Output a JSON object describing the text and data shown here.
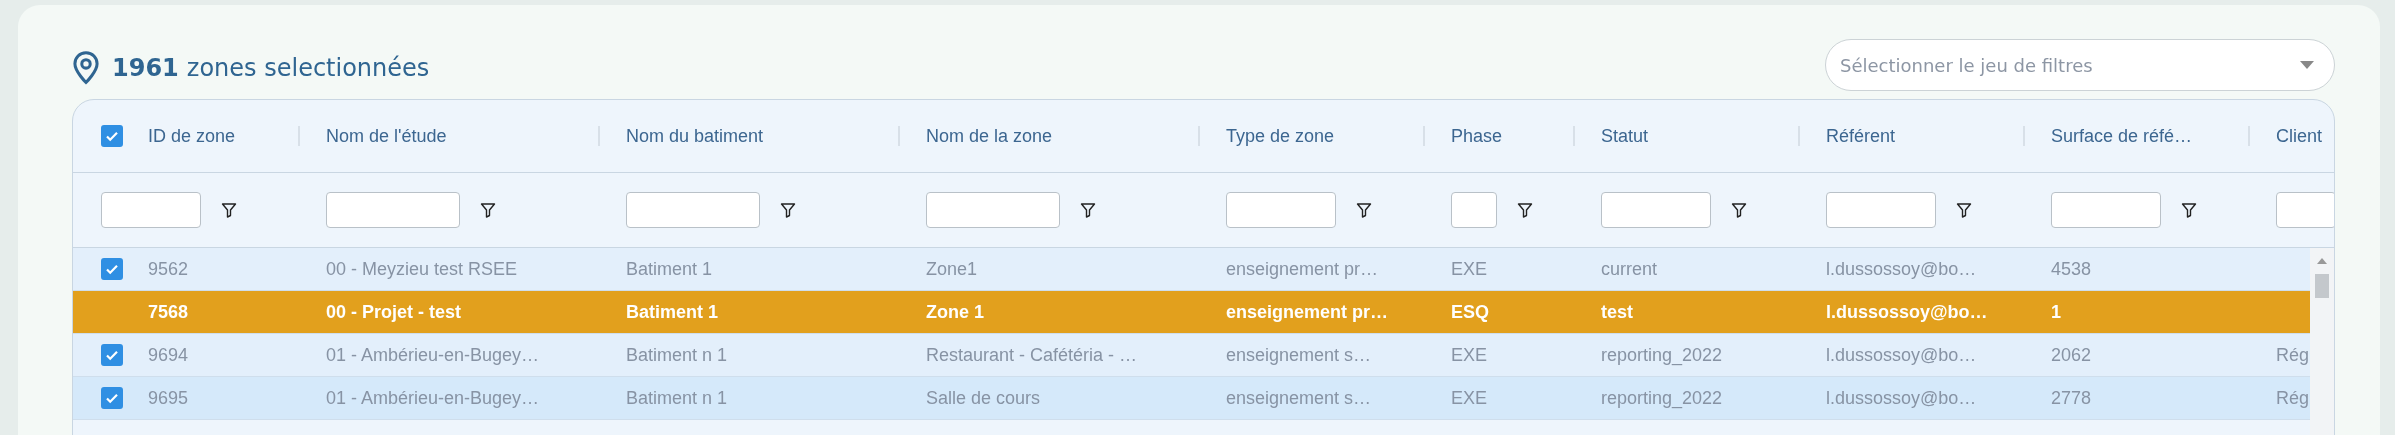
{
  "header": {
    "count": "1961",
    "label": "zones selectionnées"
  },
  "filter_set_select": {
    "placeholder": "Sélectionner le jeu de filtres"
  },
  "table": {
    "select_all": {
      "checked": true
    },
    "columns": [
      "ID de zone",
      "Nom de l'étude",
      "Nom du batiment",
      "Nom de la zone",
      "Type de zone",
      "Phase",
      "Statut",
      "Référent",
      "Surface de réfé…",
      "Client"
    ],
    "rows": [
      {
        "checked": true,
        "selected": false,
        "highlighted": false,
        "cells": [
          "9562",
          "00 - Meyzieu test RSEE",
          "Batiment 1",
          "Zone1",
          "enseignement pr…",
          "EXE",
          "current",
          "l.dussossoy@bo…",
          "4538",
          ""
        ]
      },
      {
        "checked": false,
        "selected": true,
        "highlighted": false,
        "cells": [
          "7568",
          "00 - Projet - test",
          "Batiment 1",
          "Zone 1",
          "enseignement pr…",
          "ESQ",
          "test",
          "l.dussossoy@bo…",
          "1",
          ""
        ]
      },
      {
        "checked": true,
        "selected": false,
        "highlighted": false,
        "cells": [
          "9694",
          "01 - Ambérieu-en-Bugey…",
          "Batiment n 1",
          "Restaurant - Cafétéria - …",
          "enseignement s…",
          "EXE",
          "reporting_2022",
          "l.dussossoy@bo…",
          "2062",
          "Rég"
        ]
      },
      {
        "checked": true,
        "selected": false,
        "highlighted": true,
        "cells": [
          "9695",
          "01 - Ambérieu-en-Bugey…",
          "Batiment n 1",
          "Salle de cours",
          "enseignement s…",
          "EXE",
          "reporting_2022",
          "l.dussossoy@bo…",
          "2778",
          "Rég"
        ]
      }
    ]
  }
}
